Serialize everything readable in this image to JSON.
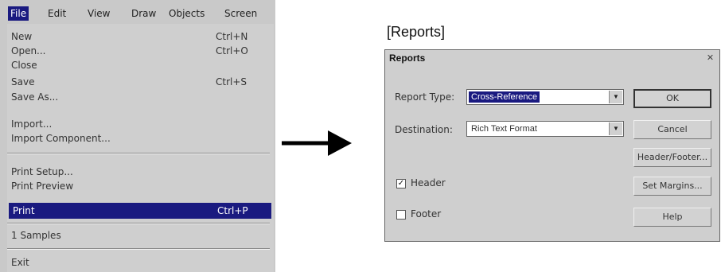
{
  "menubar": {
    "items": [
      "File",
      "Edit",
      "View",
      "Draw",
      "Objects",
      "Screen"
    ]
  },
  "file_menu": {
    "items": [
      {
        "label": "New",
        "shortcut": "Ctrl+N"
      },
      {
        "label": "Open...",
        "shortcut": "Ctrl+O"
      },
      {
        "label": "Close",
        "shortcut": ""
      },
      {
        "label": "Save",
        "shortcut": "Ctrl+S"
      },
      {
        "label": "Save As...",
        "shortcut": ""
      },
      {
        "label": "Import...",
        "shortcut": ""
      },
      {
        "label": "Import Component...",
        "shortcut": ""
      },
      {
        "label": "Print Setup...",
        "shortcut": ""
      },
      {
        "label": "Print Preview",
        "shortcut": ""
      },
      {
        "label": "Print",
        "shortcut": "Ctrl+P"
      },
      {
        "label": "1 Samples",
        "shortcut": ""
      },
      {
        "label": "Exit",
        "shortcut": ""
      }
    ]
  },
  "caption": "[Reports]",
  "dialog": {
    "title": "Reports",
    "close_glyph": "✕",
    "report_type_label": "Report Type:",
    "report_type_value": "Cross-Reference",
    "destination_label": "Destination:",
    "destination_value": "Rich Text Format",
    "header_label": "Header",
    "header_checked": true,
    "footer_label": "Footer",
    "footer_checked": false,
    "buttons": {
      "ok": "OK",
      "cancel": "Cancel",
      "header_footer": "Header/Footer...",
      "set_margins": "Set Margins...",
      "help": "Help"
    }
  },
  "colors": {
    "highlight": "#1a1a80",
    "face": "#cfcfcf"
  }
}
